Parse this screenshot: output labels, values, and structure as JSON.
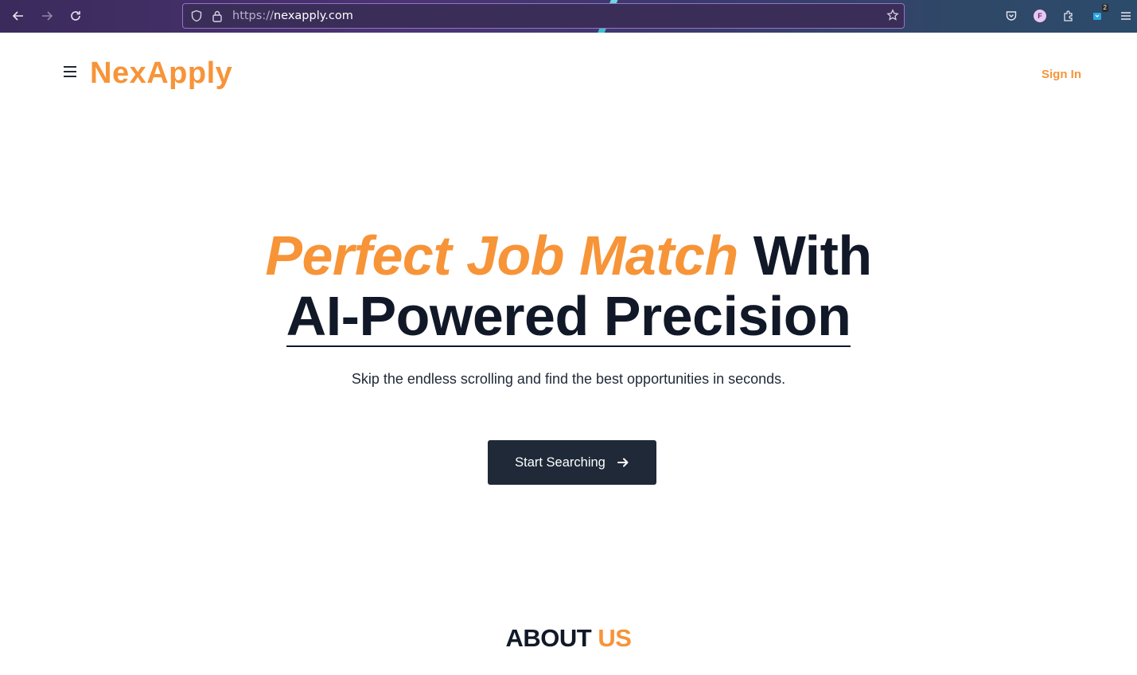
{
  "browser": {
    "url_scheme": "https://",
    "url_host": "nexapply.com",
    "profile_initial": "F",
    "extension_badge": "2",
    "icons": [
      "back-icon",
      "forward-icon",
      "reload-icon",
      "shield-icon",
      "lock-icon",
      "star-icon",
      "pocket-icon",
      "profile-icon",
      "extensions-icon",
      "extension-icon",
      "menu-icon"
    ]
  },
  "header": {
    "menu_glyph": "☰",
    "logo": "NexApply",
    "signin_label": "Sign In"
  },
  "hero": {
    "title_accent": "Perfect Job Match",
    "title_dark": "With",
    "title_line2": "AI-Powered Precision",
    "subtitle": "Skip the endless scrolling and find the best opportunities in seconds.",
    "cta_label": "Start Searching"
  },
  "about": {
    "heading_dark": "ABOUT",
    "heading_accent": "US"
  },
  "colors": {
    "accent": "#f79438",
    "dark": "#111827",
    "button_bg": "#1f2937"
  }
}
